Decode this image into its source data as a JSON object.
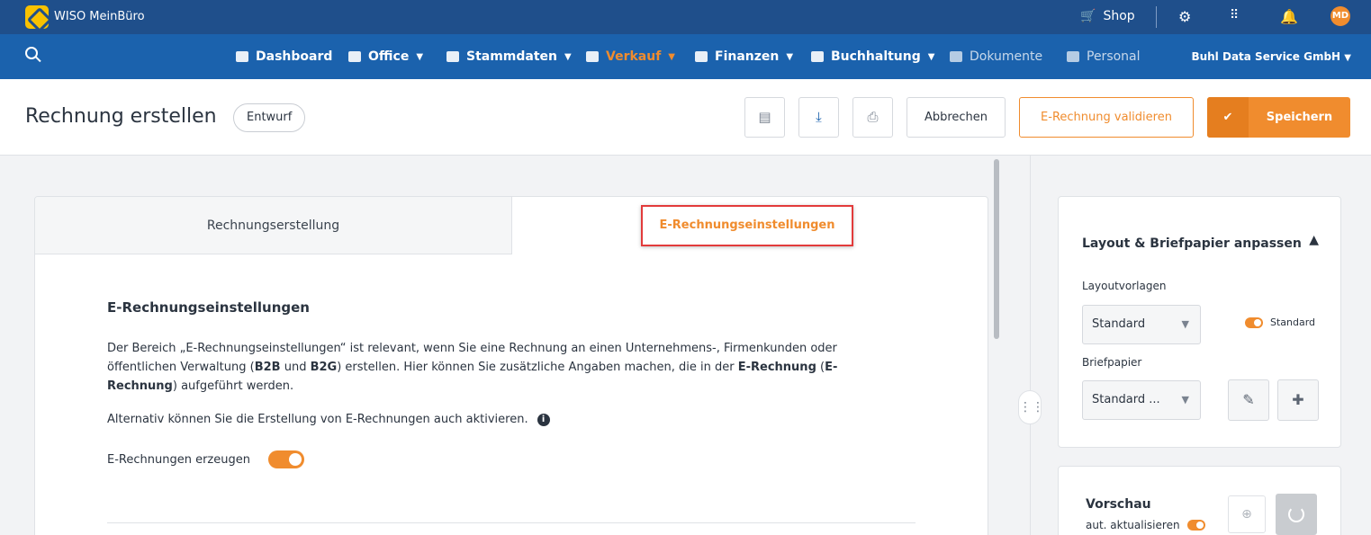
{
  "app": {
    "name": "WISO MeinBüro"
  },
  "topbar": {
    "shop_label": "Shop",
    "avatar_initials": "MD"
  },
  "nav": {
    "items": [
      {
        "label": "Dashboard",
        "icon": "dashboard-icon"
      },
      {
        "label": "Office",
        "icon": "office-icon",
        "has_dropdown": true
      },
      {
        "label": "Stammdaten",
        "icon": "person-icon",
        "has_dropdown": true
      },
      {
        "label": "Verkauf",
        "icon": "document-icon",
        "has_dropdown": true,
        "active": true
      },
      {
        "label": "Finanzen",
        "icon": "bank-icon",
        "has_dropdown": true
      },
      {
        "label": "Buchhaltung",
        "icon": "ledger-icon",
        "has_dropdown": true
      },
      {
        "label": "Dokumente",
        "icon": "folder-icon"
      },
      {
        "label": "Personal",
        "icon": "id-card-icon"
      }
    ],
    "company": "Buhl Data Service GmbH"
  },
  "header": {
    "title": "Rechnung erstellen",
    "status_badge": "Entwurf",
    "cancel_label": "Abbrechen",
    "validate_label": "E-Rechnung validieren",
    "save_label": "Speichern"
  },
  "tabs": [
    {
      "label": "Rechnungserstellung",
      "active": false
    },
    {
      "label": "E-Rechnungseinstellungen",
      "active": true
    }
  ],
  "einstellungen": {
    "title": "E-Rechnungseinstellungen",
    "desc_p1": "Der Bereich „E-Rechnungseinstellungen“ ist relevant, wenn Sie eine Rechnung an einen Unternehmens-, Firmenkunden oder öffentlichen Verwaltung (",
    "desc_b2b": "B2B",
    "desc_und": " und ",
    "desc_b2g": "B2G",
    "desc_p2": ") erstellen. Hier können Sie zusätzliche Angaben machen, die in der ",
    "desc_erech1": "E-Rechnung",
    "desc_paren_open": " (",
    "desc_erech2": "E-Rechnung",
    "desc_p3": ") aufgeführt werden.",
    "alternativ": "Alternativ können Sie die Erstellung von E-Rechnungen auch aktivieren.",
    "erzeugen_label": "E-Rechnungen erzeugen",
    "erzeugen_on": true
  },
  "layout_panel": {
    "title": "Layout & Briefpapier anpassen",
    "layoutvorlagen_label": "Layoutvorlagen",
    "layoutvorlagen_value": "Standard",
    "standard_toggle_label": "Standard",
    "briefpapier_label": "Briefpapier",
    "briefpapier_value": "Standard ..."
  },
  "preview_panel": {
    "title": "Vorschau",
    "auto_update_label": "aut. aktualisieren"
  },
  "colors": {
    "brand_dark": "#1f4f8b",
    "nav_blue": "#1b62ad",
    "accent": "#f08c2e",
    "highlight": "#e23b3b"
  }
}
